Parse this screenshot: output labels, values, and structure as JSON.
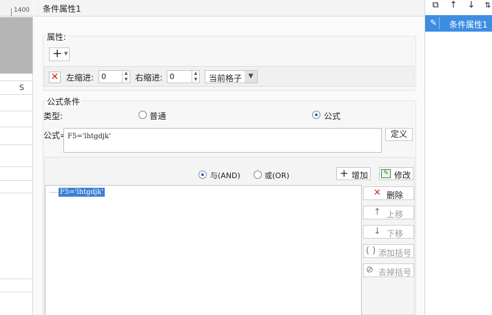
{
  "sheet": {
    "ruler_label": "1400",
    "column_label": "S"
  },
  "dialog": {
    "title": "条件属性1"
  },
  "attributes": {
    "label": "属性:",
    "add_icon": "plus-icon",
    "left_indent_label": "左缩进:",
    "left_indent_value": "0",
    "right_indent_label": "右缩进:",
    "right_indent_value": "0",
    "cell_select_value": "当前格子"
  },
  "formula_condition": {
    "label": "公式条件",
    "type_label": "类型:",
    "type_options": [
      "普通",
      "公式"
    ],
    "selected_type": "公式",
    "formula_label": "公式=",
    "formula_value": "F5='lhtgdjk'",
    "define_label": "定义"
  },
  "logic": {
    "and_label": "与(AND)",
    "or_label": "或(OR)",
    "selected": "与(AND)",
    "increase_label": "增加",
    "modify_label": "修改"
  },
  "conditions": [
    {
      "text": "F5='lhtgdjk'",
      "selected": true
    }
  ],
  "side_buttons": {
    "delete": "删除",
    "move_up": "上移",
    "move_down": "下移",
    "add_bracket": "添加括号",
    "remove_bracket": "去掉括号"
  },
  "right_panel": {
    "items": [
      {
        "label": "条件属性1",
        "selected": true
      }
    ]
  },
  "colors": {
    "selection": "#3d7fd6",
    "list_selection": "#3d8ee0",
    "delete_red": "#d61f1f"
  }
}
